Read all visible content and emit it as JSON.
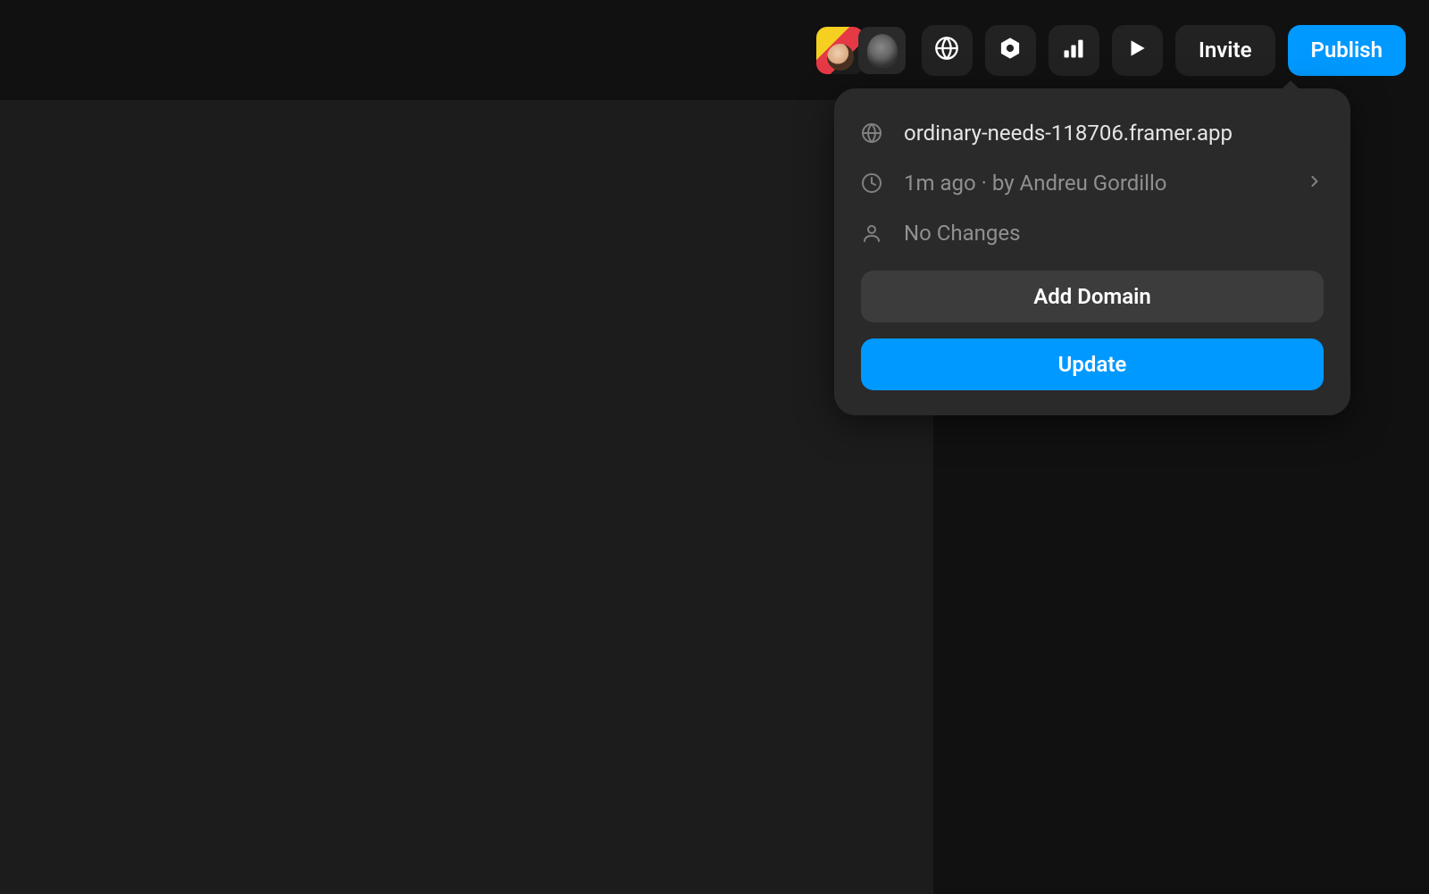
{
  "topbar": {
    "invite_label": "Invite",
    "publish_label": "Publish"
  },
  "popover": {
    "domain_url": "ordinary-needs-118706.framer.app",
    "time_author": "1m ago · by Andreu Gordillo",
    "changes_status": "No Changes",
    "add_domain_label": "Add Domain",
    "update_label": "Update"
  },
  "colors": {
    "accent": "#0099ff",
    "bg_dark": "#111111",
    "bg_canvas": "#1c1c1c",
    "panel": "#2a2a2a"
  }
}
